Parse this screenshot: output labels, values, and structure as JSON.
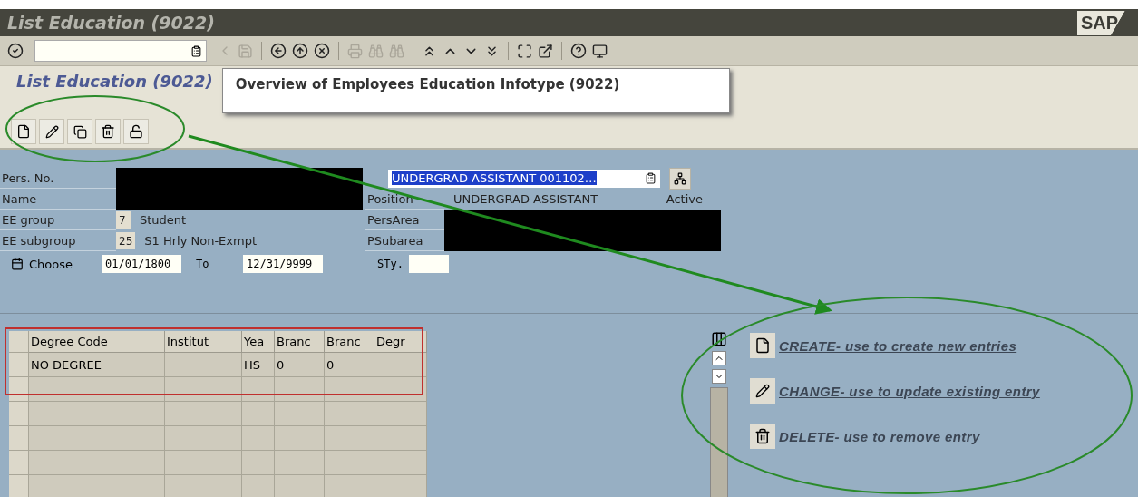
{
  "window": {
    "title": "List Education (9022)",
    "logo": "SAP"
  },
  "screen_title": "List Education (9022)",
  "callout": "Overview of Employees Education Infotype (9022)",
  "header": {
    "pers_no_label": "Pers. No.",
    "name_label": "Name",
    "ee_group": {
      "label": "EE group",
      "code": "7",
      "text": "Student"
    },
    "ee_subgroup": {
      "label": "EE subgroup",
      "code": "25",
      "text": "S1 Hrly Non-Exmpt"
    },
    "assignment": {
      "value": "UNDERGRAD ASSISTANT 001102…",
      "selected": true
    },
    "position": {
      "label": "Position",
      "value": "UNDERGRAD ASSISTANT",
      "status": "Active"
    },
    "pers_area_label": "PersArea",
    "psubarea_label": "PSubarea"
  },
  "period": {
    "label": "Choose",
    "from": "01/01/1800",
    "to_label": "To",
    "to": "12/31/9999",
    "sty_label": "STy."
  },
  "table": {
    "columns": [
      "Degree Code",
      "Institut",
      "Yea",
      "Branc",
      "Branc",
      "Degr"
    ],
    "rows": [
      [
        "NO DEGREE",
        null,
        "HS",
        "0",
        "0",
        null
      ]
    ]
  },
  "legend": [
    {
      "kind": "create",
      "text": "CREATE- use to create new entries"
    },
    {
      "kind": "change",
      "text": "CHANGE- use to update existing entry"
    },
    {
      "kind": "delete",
      "text": "DELETE- use to remove entry"
    }
  ]
}
